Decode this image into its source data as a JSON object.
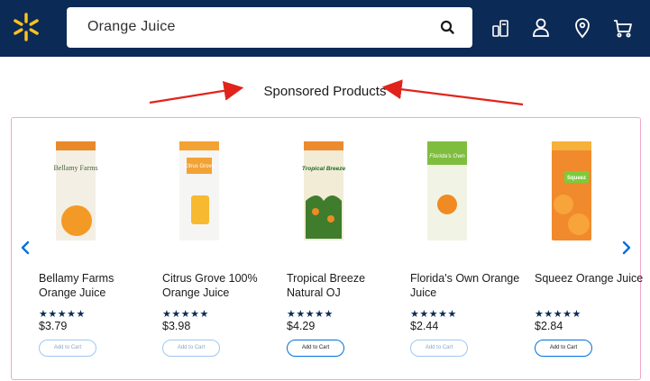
{
  "header": {
    "search_value": "Orange Juice"
  },
  "colors": {
    "header_bg": "#0b2a55",
    "spark": "#ffc220",
    "accent": "#0071dc",
    "carousel_border": "#f3a7c9",
    "annotation_arrow": "#e0241b"
  },
  "icons": [
    "spark-logo-icon",
    "search-icon",
    "reorder-icon",
    "account-icon",
    "location-icon",
    "cart-icon",
    "chevron-left-icon",
    "chevron-right-icon"
  ],
  "section": {
    "title": "Sponsored Products"
  },
  "products": [
    {
      "name": "Bellamy Farms Orange Juice",
      "stars": "★★★★★",
      "price": "$3.79",
      "cart_label": "Add to Cart"
    },
    {
      "name": "Citrus Grove 100% Orange Juice",
      "stars": "★★★★★",
      "price": "$3.98",
      "cart_label": "Add to Cart"
    },
    {
      "name": "Tropical Breeze Natural OJ",
      "stars": "★★★★★",
      "price": "$4.29",
      "cart_label": "Add to Cart"
    },
    {
      "name": "Florida's Own Orange Juice",
      "stars": "★★★★★",
      "price": "$2.44",
      "cart_label": "Add to Cart"
    },
    {
      "name": "Squeez Orange Juice",
      "stars": "★★★★★",
      "price": "$2.84",
      "cart_label": "Add to Cart"
    }
  ],
  "packaging": [
    {
      "brand": "Bellamy Farms",
      "carton": "#f4efe4",
      "band": "#e88a2a"
    },
    {
      "brand": "Citrus Grove",
      "carton": "#f5f5f3",
      "band": "#f3a234"
    },
    {
      "brand": "Tropical Breeze",
      "carton": "#f2ecd6",
      "band": "#ec8a2e"
    },
    {
      "brand": "Florida's Own",
      "carton": "#f1f4e4",
      "band": "#7fbd3f"
    },
    {
      "brand": "Squeez",
      "carton": "#f08a2d",
      "band": "#f6b13a"
    }
  ]
}
